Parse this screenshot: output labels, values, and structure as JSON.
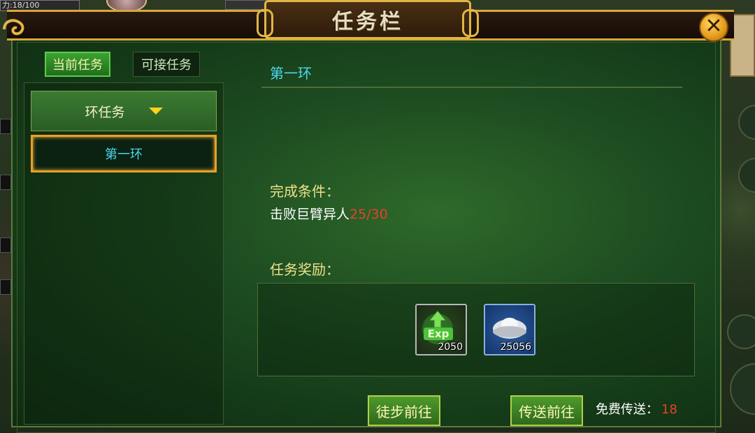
{
  "hud": {
    "hp_prefix": "力:",
    "hp_value": "18/100"
  },
  "window": {
    "title": "任务栏",
    "close_label": "✕"
  },
  "tabs": [
    {
      "label": "当前任务",
      "active": true
    },
    {
      "label": "可接任务",
      "active": false
    }
  ],
  "quest_list": {
    "group_label": "环任务",
    "items": [
      {
        "label": "第一环",
        "selected": true
      }
    ]
  },
  "quest_detail": {
    "name": "第一环",
    "condition_title": "完成条件：",
    "condition_text": "击败巨臂异人",
    "condition_progress": "25/30",
    "reward_title": "任务奖励：",
    "rewards": [
      {
        "icon": "exp-icon",
        "quantity": "2050"
      },
      {
        "icon": "silver-ingot-icon",
        "quantity": "25056"
      }
    ]
  },
  "actions": {
    "walk_label": "徒步前往",
    "teleport_label": "传送前往",
    "free_teleport_label": "免费传送：",
    "free_teleport_count": "18"
  },
  "colors": {
    "accent_gold": "#e0b645",
    "quest_name_cyan": "#4fd8f0",
    "section_title_yellow": "#f0e08a",
    "progress_red": "#e8402c"
  }
}
